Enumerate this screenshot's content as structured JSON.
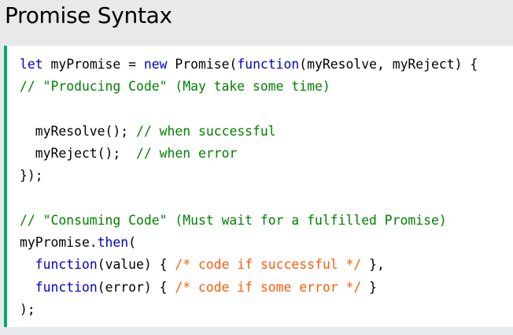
{
  "page": {
    "title": "Promise Syntax"
  },
  "colors": {
    "background": "#e7e9eb",
    "panel": "#ffffff",
    "accent_border": "#04aa6d",
    "keyword": "#0000cd",
    "comment": "#008000",
    "block_comment": "#ff5a0a",
    "text": "#000000"
  },
  "code": {
    "line1": {
      "t1": "let",
      "t2": " myPromise = ",
      "t3": "new",
      "t4": " Promise(",
      "t5": "function",
      "t6": "(myResolve, myReject) {"
    },
    "line2": {
      "t1": "// \"Producing Code\" (May take some time)"
    },
    "line3": {
      "t1": ""
    },
    "line4": {
      "t1": "  myResolve(); ",
      "t2": "// when successful"
    },
    "line5": {
      "t1": "  myReject();  ",
      "t2": "// when error"
    },
    "line6": {
      "t1": "});"
    },
    "line7": {
      "t1": ""
    },
    "line8": {
      "t1": "// \"Consuming Code\" (Must wait for a fulfilled Promise)"
    },
    "line9": {
      "t1": "myPromise.",
      "t2": "then",
      "t3": "("
    },
    "line10": {
      "t1": "  ",
      "t2": "function",
      "t3": "(value) { ",
      "t4": "/* code if successful */",
      "t5": " },"
    },
    "line11": {
      "t1": "  ",
      "t2": "function",
      "t3": "(error) { ",
      "t4": "/* code if some error */",
      "t5": " }"
    },
    "line12": {
      "t1": ");"
    }
  }
}
